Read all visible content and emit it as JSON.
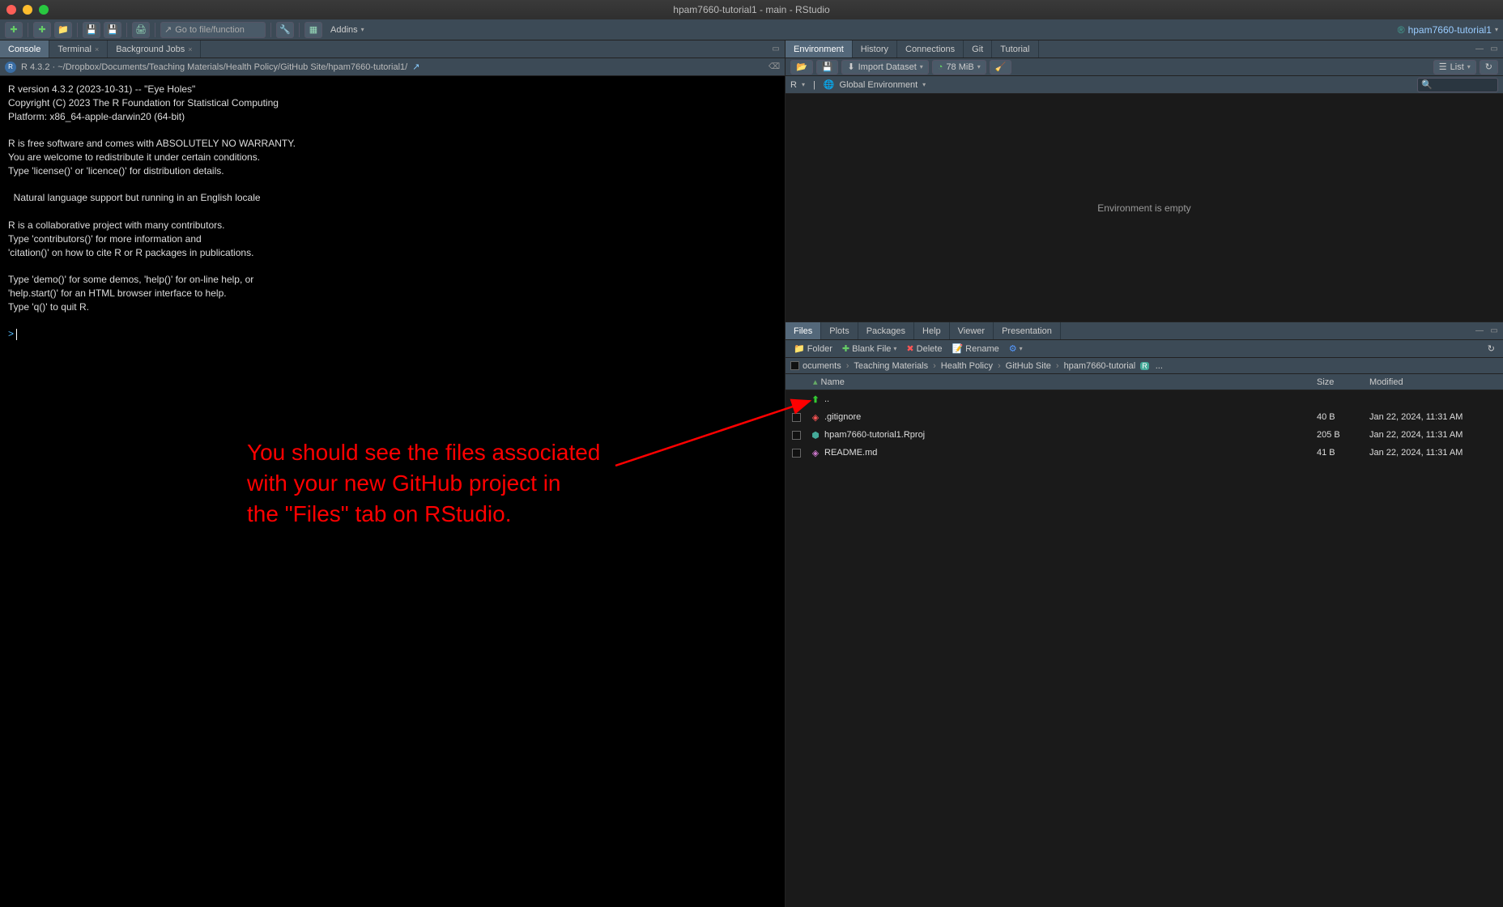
{
  "titlebar": {
    "title": "hpam7660-tutorial1 - main - RStudio"
  },
  "toolbar": {
    "goto_placeholder": "Go to file/function",
    "addins_label": "Addins",
    "project_label": "hpam7660-tutorial1"
  },
  "left": {
    "tabs": [
      {
        "label": "Console",
        "active": true
      },
      {
        "label": "Terminal",
        "active": false
      },
      {
        "label": "Background Jobs",
        "active": false
      }
    ],
    "console_version": "R 4.3.2 · ~/Dropbox/Documents/Teaching Materials/Health Policy/GitHub Site/hpam7660-tutorial1/",
    "console_text": "R version 4.3.2 (2023-10-31) -- \"Eye Holes\"\nCopyright (C) 2023 The R Foundation for Statistical Computing\nPlatform: x86_64-apple-darwin20 (64-bit)\n\nR is free software and comes with ABSOLUTELY NO WARRANTY.\nYou are welcome to redistribute it under certain conditions.\nType 'license()' or 'licence()' for distribution details.\n\n  Natural language support but running in an English locale\n\nR is a collaborative project with many contributors.\nType 'contributors()' for more information and\n'citation()' on how to cite R or R packages in publications.\n\nType 'demo()' for some demos, 'help()' for on-line help, or\n'help.start()' for an HTML browser interface to help.\nType 'q()' to quit R.\n",
    "prompt": "> "
  },
  "right_top": {
    "tabs": [
      {
        "label": "Environment",
        "active": true
      },
      {
        "label": "History",
        "active": false
      },
      {
        "label": "Connections",
        "active": false
      },
      {
        "label": "Git",
        "active": false
      },
      {
        "label": "Tutorial",
        "active": false
      }
    ],
    "import_label": "Import Dataset",
    "memory_label": "78 MiB",
    "list_label": "List",
    "scope_r": "R",
    "scope_env": "Global Environment",
    "empty_text": "Environment is empty"
  },
  "right_bottom": {
    "tabs": [
      {
        "label": "Files",
        "active": true
      },
      {
        "label": "Plots",
        "active": false
      },
      {
        "label": "Packages",
        "active": false
      },
      {
        "label": "Help",
        "active": false
      },
      {
        "label": "Viewer",
        "active": false
      },
      {
        "label": "Presentation",
        "active": false
      }
    ],
    "toolbar": {
      "folder": "Folder",
      "blank_file": "Blank File",
      "delete": "Delete",
      "rename": "Rename"
    },
    "breadcrumb": [
      "ocuments",
      "Teaching Materials",
      "Health Policy",
      "GitHub Site",
      "hpam7660-tutorial"
    ],
    "columns": {
      "name": "Name",
      "size": "Size",
      "modified": "Modified"
    },
    "up_dir": "..",
    "files": [
      {
        "name": ".gitignore",
        "size": "40 B",
        "modified": "Jan 22, 2024, 11:31 AM",
        "icon": "gitignore"
      },
      {
        "name": "hpam7660-tutorial1.Rproj",
        "size": "205 B",
        "modified": "Jan 22, 2024, 11:31 AM",
        "icon": "rproj"
      },
      {
        "name": "README.md",
        "size": "41 B",
        "modified": "Jan 22, 2024, 11:31 AM",
        "icon": "md"
      }
    ]
  },
  "annotation": {
    "line1": "You should see the files associated",
    "line2": "with your new GitHub project in",
    "line3": "the \"Files\" tab on RStudio."
  }
}
